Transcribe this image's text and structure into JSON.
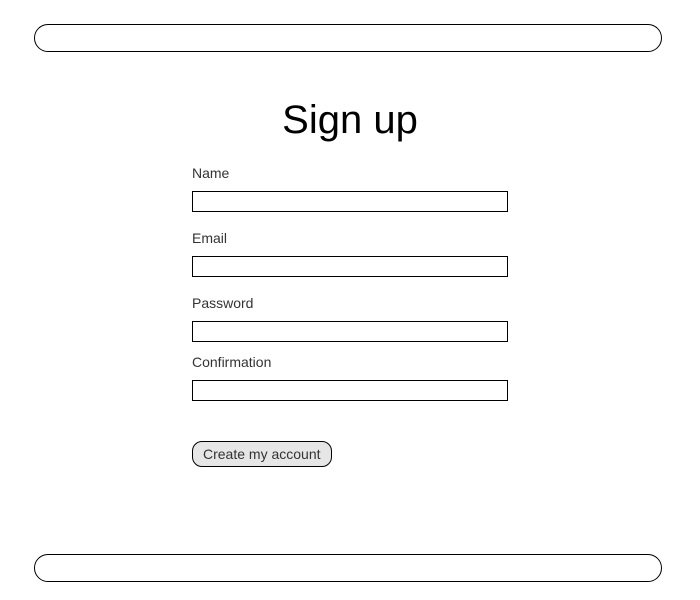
{
  "title": "Sign up",
  "form": {
    "name": {
      "label": "Name",
      "value": ""
    },
    "email": {
      "label": "Email",
      "value": ""
    },
    "password": {
      "label": "Password",
      "value": ""
    },
    "confirmation": {
      "label": "Confirmation",
      "value": ""
    },
    "submit_label": "Create my account"
  }
}
